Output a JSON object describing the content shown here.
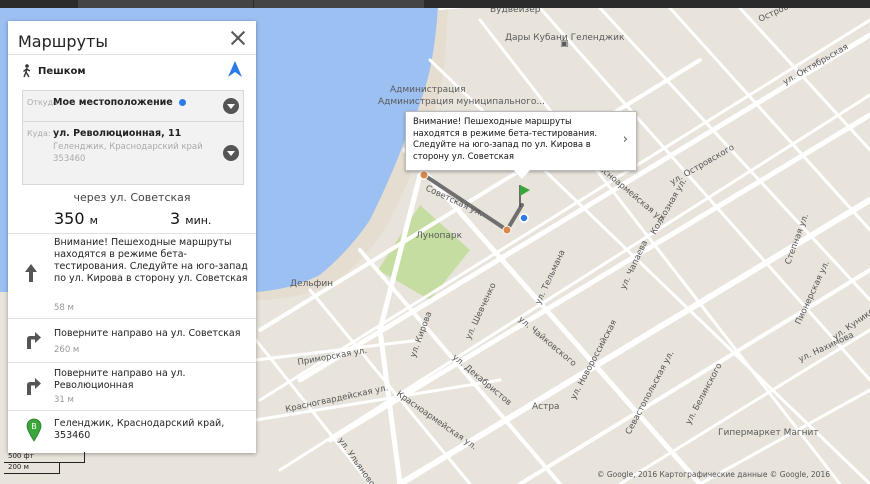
{
  "panel": {
    "title": "Маршруты",
    "close_label": "×",
    "mode": "Пешком",
    "from_label": "Откуда",
    "from_value": "Мое местоположение",
    "to_label": "Куда:",
    "to_value": "ул. Революционная, 11",
    "to_sub": "Геленджик, Краснодарский край 353460",
    "via": "через ул. Советская",
    "distance_value": "350",
    "distance_unit": "м",
    "time_value": "3",
    "time_unit": "мин.",
    "steps": [
      {
        "icon": "straight-arrow-icon",
        "text": "Внимание! Пешеходные маршруты находятся в режиме бета-тестирования. Следуйте на юго-запад по ул. Кирова в сторону ул. Советская",
        "dist": "58 м"
      },
      {
        "icon": "turn-right-icon",
        "text": "Поверните направо на ул. Советская",
        "dist": "260 м"
      },
      {
        "icon": "turn-right-icon",
        "text": "Поверните направо на ул. Революционная",
        "dist": "31 м"
      },
      {
        "icon": "destination-marker-icon",
        "marker": "B",
        "text": "Геленджик, Краснодарский край, 353460",
        "dist": ""
      }
    ]
  },
  "infobox": {
    "text": "Внимание! Пешеходные маршруты находятся в режиме бета-тестирования. Следуйте на юго-запад по ул. Кирова в сторону ул. Советская",
    "chevron": "›"
  },
  "map": {
    "streets": {
      "kirova": "ул. Кирова",
      "sovetskaya": "Советская ул.",
      "primorskaya": "Приморская ул.",
      "krasnogvardeyskaya": "Красногвардейская ул.",
      "krasnoarmeyskaya": "Красноармейская ул.",
      "ulyanovskaya": "ул. Ульяновская",
      "shevchenko": "ул. Шевченко",
      "dekabristov": "ул. Декабристов",
      "telmana": "ул. Тельмана",
      "chaykovskogo": "ул. Чайковского",
      "chapaeva": "ул. Чапаева",
      "novorossiyskaya": "ул. Новороссийская",
      "sevastopolskaya": "Севастопольская ул.",
      "belinskogo": "ул. Белинского",
      "ostrovskogo": "ул. Островского",
      "kolkhoznaya": "Колхозная ул.",
      "krasnoarmeyskaya2": "Красноармейская ул.",
      "oktyabrskaya": "ул. Октябрьская",
      "stepnaya": "Степная ул.",
      "pionerskaya": "Пионерская ул.",
      "kunikova": "ул. Куникова",
      "nakhimova": "ул. Нахимова",
      "ostrovskogo_top": "Островского"
    },
    "pois": {
      "dary_kubani": "Дары Кубани Геленджик",
      "administration": "Администрация муниципального...",
      "lunopark": "Лунопарк",
      "delfin": "Дельфин",
      "astra": "Астра",
      "magnit": "Гипермаркет Магнит",
      "budweiser": "Будвейзер"
    },
    "route_start_marker": "A",
    "scale_ft": "500 фт",
    "scale_m": "200 м",
    "copyright": "© Google, 2016     Картографические данные © Google, 2016"
  },
  "colors": {
    "water": "#9dc0f2",
    "land": "#e8e4dc",
    "park": "#c6dda2",
    "road": "#ffffff",
    "route": "#6f6f6f",
    "accent": "#2c7be5",
    "marker_green": "#3aa63a"
  }
}
